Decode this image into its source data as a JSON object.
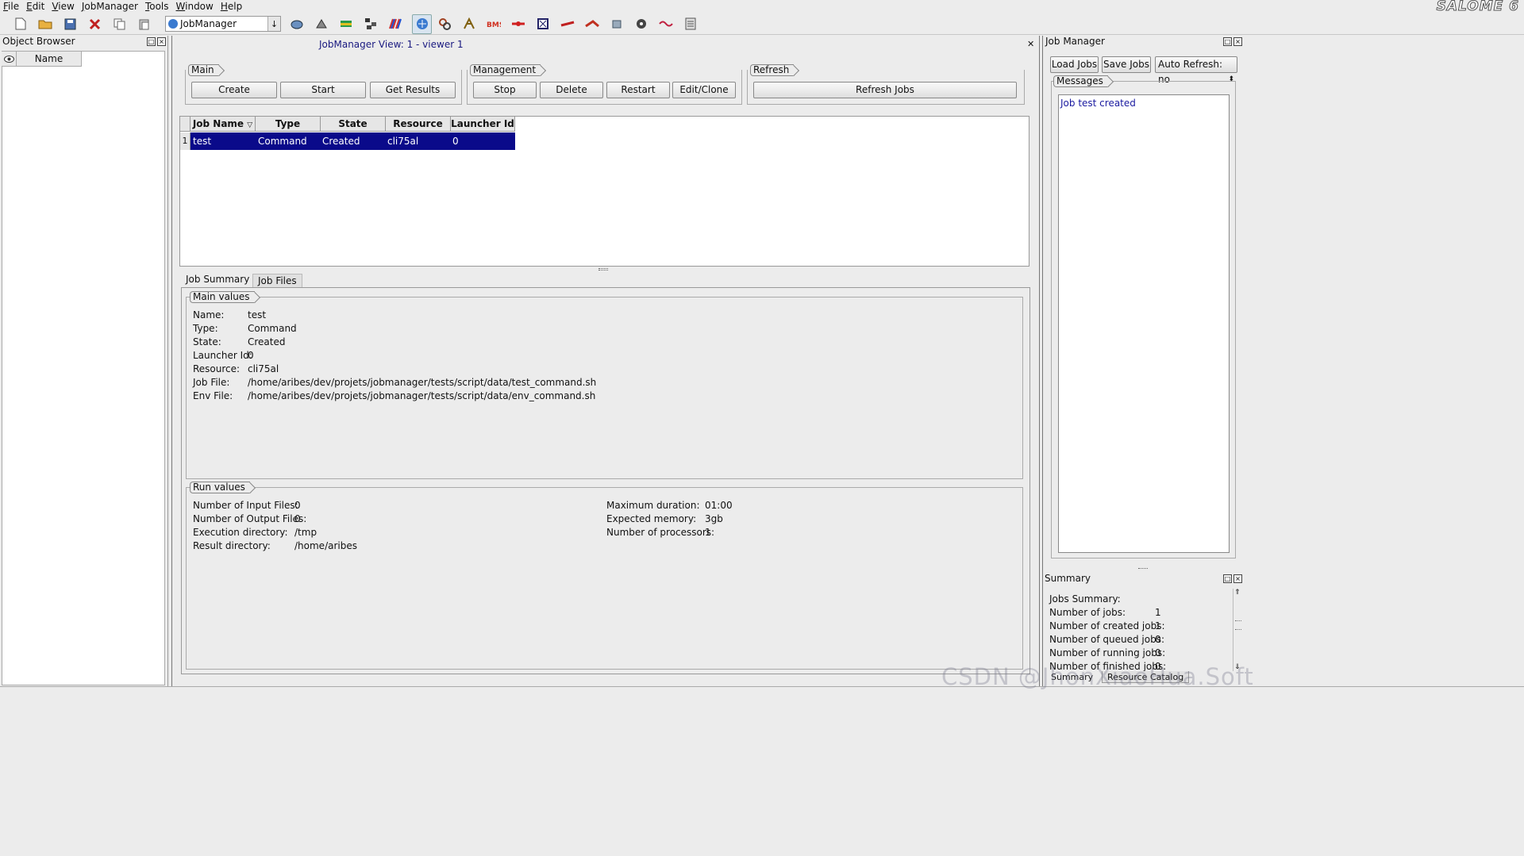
{
  "menu": [
    "File",
    "Edit",
    "View",
    "JobManager",
    "Tools",
    "Window",
    "Help"
  ],
  "logo": "SALOME 6",
  "toolbar": {
    "module_combo": "JobManager",
    "icons": [
      "new-document-icon",
      "open-folder-icon",
      "save-icon",
      "close-study-icon",
      "copy-icon",
      "paste-icon",
      "geometry-module-icon",
      "mesh-module-icon",
      "post-pro-module-icon",
      "yacs-module-icon",
      "paravis-module-icon",
      "jobmanager-module-icon",
      "hexablock-module-icon",
      "homard-module-icon",
      "smesh-module-icon",
      "med-module-icon",
      "filter-module-icon",
      "blsurf-module-icon",
      "pipe-module-icon",
      "tool-module-icon",
      "gear-module-icon",
      "swig-module-icon",
      "report-module-icon"
    ]
  },
  "object_browser": {
    "title": "Object Browser",
    "column": "Name"
  },
  "view": {
    "title": "JobManager View: 1 - viewer 1"
  },
  "groups": {
    "main": {
      "title": "Main",
      "buttons": [
        "Create",
        "Start",
        "Get Results"
      ]
    },
    "management": {
      "title": "Management",
      "buttons": [
        "Stop",
        "Delete",
        "Restart",
        "Edit/Clone"
      ]
    },
    "refresh": {
      "title": "Refresh",
      "buttons": [
        "Refresh Jobs"
      ]
    }
  },
  "table": {
    "headers": [
      "Job Name",
      "Type",
      "State",
      "Resource",
      "Launcher Id"
    ],
    "rows": [
      {
        "num": "1",
        "cells": [
          "test",
          "Command",
          "Created",
          "cli75al",
          "0"
        ]
      }
    ]
  },
  "tabs": [
    "Job Summary",
    "Job Files"
  ],
  "main_values": {
    "title": "Main values",
    "items": [
      {
        "k": "Name:",
        "v": "test"
      },
      {
        "k": "Type:",
        "v": "Command"
      },
      {
        "k": "State:",
        "v": "Created"
      },
      {
        "k": "Launcher Id:",
        "v": "0"
      },
      {
        "k": "Resource:",
        "v": "cli75al"
      },
      {
        "k": "Job File:",
        "v": "/home/aribes/dev/projets/jobmanager/tests/script/data/test_command.sh"
      },
      {
        "k": "Env File:",
        "v": "/home/aribes/dev/projets/jobmanager/tests/script/data/env_command.sh"
      }
    ]
  },
  "run_values": {
    "title": "Run values",
    "left": [
      {
        "k": "Number of Input Files:",
        "v": "0"
      },
      {
        "k": "Number of Output Files:",
        "v": "0"
      },
      {
        "k": "Execution directory:",
        "v": "/tmp"
      },
      {
        "k": "Result directory:",
        "v": "/home/aribes"
      }
    ],
    "right": [
      {
        "k": "Maximum duration:",
        "v": "01:00"
      },
      {
        "k": "Expected memory:",
        "v": "3gb"
      },
      {
        "k": "Number of processors:",
        "v": "1"
      }
    ]
  },
  "job_manager": {
    "title": "Job Manager",
    "buttons": [
      "Load Jobs",
      "Save Jobs",
      "Auto Refresh: no"
    ],
    "messages_title": "Messages",
    "messages": [
      "Job test created"
    ]
  },
  "summary": {
    "title": "Summary",
    "heading": "Jobs Summary:",
    "items": [
      {
        "k": "Number of jobs:",
        "v": "1"
      },
      {
        "k": "Number of created jobs:",
        "v": "1"
      },
      {
        "k": "Number of queued jobs:",
        "v": "0"
      },
      {
        "k": "Number of running jobs:",
        "v": "0"
      },
      {
        "k": "Number of finished jobs:",
        "v": "0"
      }
    ],
    "tabs": [
      "Summary",
      "Resource Catalog"
    ]
  },
  "watermark": "CSDN @JhonXiaoHua.Soft",
  "colors": {
    "selection": "#0a0a8a",
    "view_title": "#1a1a80",
    "message": "#1a1aa0"
  }
}
